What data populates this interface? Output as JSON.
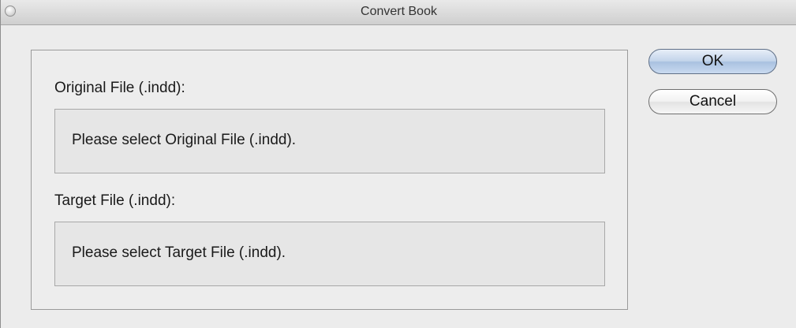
{
  "window": {
    "title": "Convert Book"
  },
  "original": {
    "label": "Original File (.indd):",
    "placeholder": "Please select Original File (.indd)."
  },
  "target": {
    "label": "Target File (.indd):",
    "placeholder": "Please select Target File (.indd)."
  },
  "buttons": {
    "ok_label": "OK",
    "cancel_label": "Cancel"
  },
  "icons": {
    "window_control": "window-control-icon"
  }
}
